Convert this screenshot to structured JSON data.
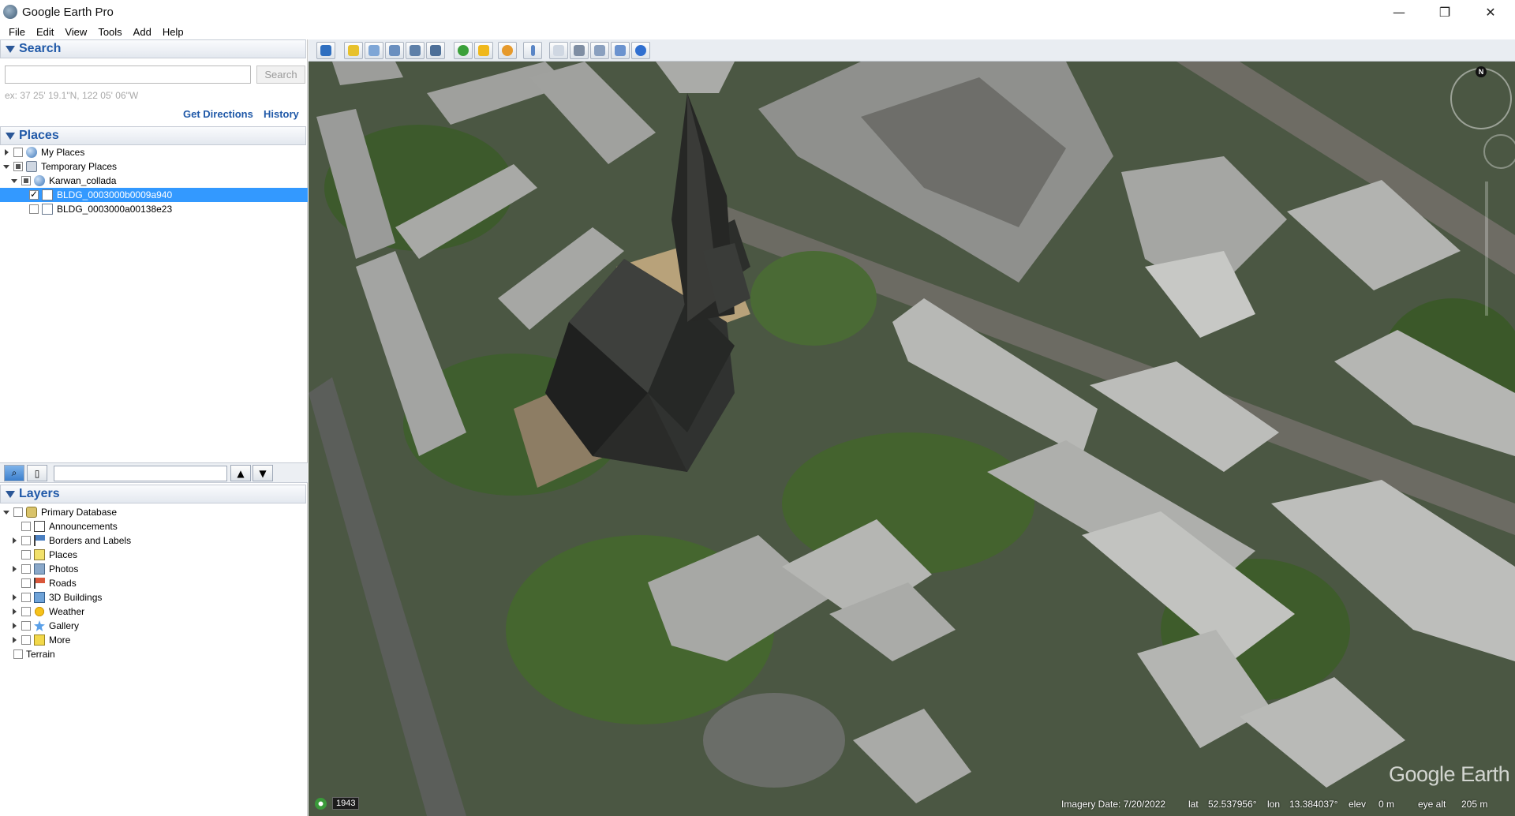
{
  "window": {
    "title": "Google Earth Pro",
    "controls": {
      "minimize": "—",
      "maximize": "❐",
      "close": "✕"
    }
  },
  "menu": [
    "File",
    "Edit",
    "View",
    "Tools",
    "Add",
    "Help"
  ],
  "search": {
    "heading": "Search",
    "placeholder": "",
    "button": "Search",
    "hint": "ex: 37 25' 19.1\"N, 122 05' 06\"W",
    "get_directions": "Get Directions",
    "history": "History"
  },
  "places": {
    "heading": "Places",
    "items": [
      {
        "label": "My Places",
        "checked": "none"
      },
      {
        "label": "Temporary Places",
        "checked": "partial"
      },
      {
        "label": "Karwan_collada",
        "checked": "partial"
      },
      {
        "label": "BLDG_0003000b0009a940",
        "checked": "checked",
        "selected": true
      },
      {
        "label": "BLDG_0003000a00138e23",
        "checked": "none"
      }
    ]
  },
  "layers": {
    "heading": "Layers",
    "items": [
      {
        "label": "Primary Database",
        "icon": "db-icon"
      },
      {
        "label": "Announcements",
        "icon": "mail-icon"
      },
      {
        "label": "Borders and Labels",
        "icon": "flag-icon"
      },
      {
        "label": "Places",
        "icon": "places-icon"
      },
      {
        "label": "Photos",
        "icon": "photo-icon"
      },
      {
        "label": "Roads",
        "icon": "road-icon"
      },
      {
        "label": "3D Buildings",
        "icon": "building-icon"
      },
      {
        "label": "Weather",
        "icon": "weather-icon"
      },
      {
        "label": "Gallery",
        "icon": "gallery-icon"
      },
      {
        "label": "More",
        "icon": "more-icon"
      },
      {
        "label": "Terrain",
        "icon": ""
      }
    ]
  },
  "status": {
    "year": "1943",
    "imagery_date": "Imagery Date: 7/20/2022",
    "lat_label": "lat",
    "lat": "52.537956°",
    "lon_label": "lon",
    "lon": "13.384037°",
    "elev_label": "elev",
    "elev": "0 m",
    "eye_label": "eye alt",
    "eye": "205 m"
  },
  "logo": "Google Earth",
  "compass_north": "N",
  "colors": {
    "accent": "#2059a8",
    "selection": "#3399ff"
  }
}
